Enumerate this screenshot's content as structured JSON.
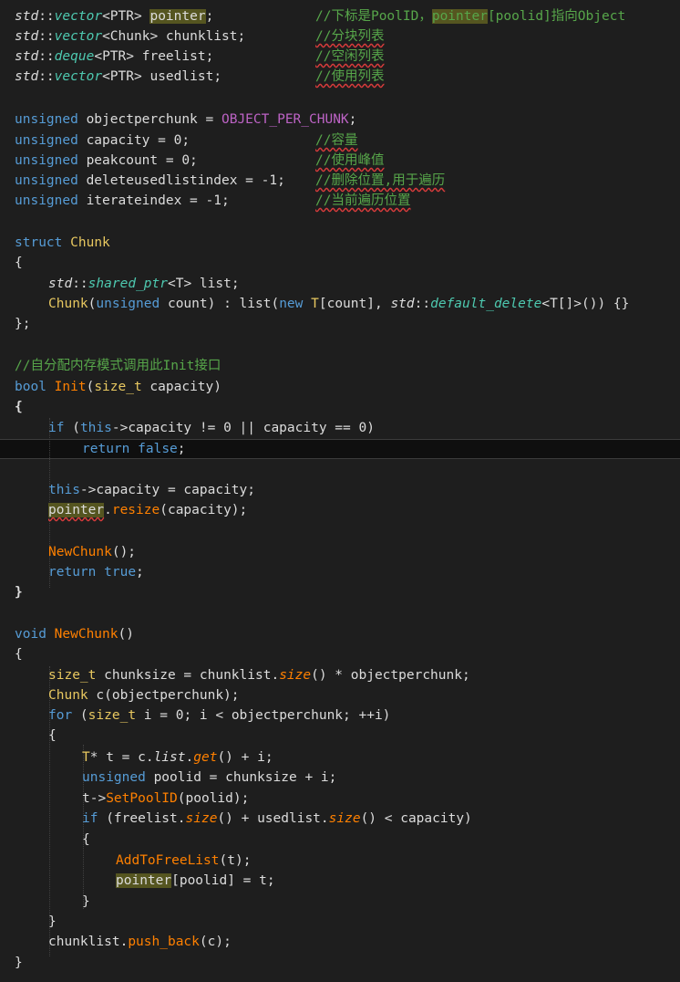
{
  "code": {
    "ln_vector_pointer": {
      "ns": "std",
      "sep": "::",
      "type": "vector",
      "lt": "<",
      "arg": "PTR",
      "gt": ">",
      "name": "pointer",
      "semi": ";",
      "comment_a": "//下标是PoolID，",
      "comment_hl": "pointer",
      "comment_b": "[poolid]指向Object"
    },
    "ln_vector_chunklist": {
      "ns": "std",
      "sep": "::",
      "type": "vector",
      "lt": "<",
      "arg": "Chunk",
      "gt": ">",
      "name": " chunklist",
      "semi": ";",
      "comment": "//分块列表"
    },
    "ln_deque_freelist": {
      "ns": "std",
      "sep": "::",
      "type": "deque",
      "lt": "<",
      "arg": "PTR",
      "gt": ">",
      "name": " freelist",
      "semi": ";",
      "comment": "//空闲列表"
    },
    "ln_vector_usedlist": {
      "ns": "std",
      "sep": "::",
      "type": "vector",
      "lt": "<",
      "arg": "PTR",
      "gt": ">",
      "name": " usedlist",
      "semi": ";",
      "comment": "//使用列表"
    },
    "ln_objectperchunk": {
      "kw": "unsigned",
      "rest": " objectperchunk = ",
      "macro": "OBJECT_PER_CHUNK",
      "semi": ";"
    },
    "ln_capacity": {
      "kw": "unsigned",
      "rest": " capacity = 0;",
      "comment": "//容量"
    },
    "ln_peakcount": {
      "kw": "unsigned",
      "rest": " peakcount = 0;",
      "comment": "//使用峰值"
    },
    "ln_deleteindex": {
      "kw": "unsigned",
      "rest": " deleteusedlistindex = -1;",
      "comment": "//删除位置,用于遍历"
    },
    "ln_iterateindex": {
      "kw": "unsigned",
      "rest": " iterateindex = -1;",
      "comment": "//当前遍历位置"
    },
    "ln_struct_chunk": {
      "kw": "struct",
      "name": "Chunk"
    },
    "ln_brace_open_1": {
      "text": "{"
    },
    "ln_shared_ptr": {
      "ns": "std",
      "sep": "::",
      "type": "shared_ptr",
      "lt": "<",
      "arg": "T",
      "gt": ">",
      "rest": " list;"
    },
    "ln_chunk_ctor": {
      "name": "Chunk",
      "p1": "(",
      "kw": "unsigned",
      "p2": " count) : list(",
      "kw2": "new",
      "sp": " ",
      "type": "T",
      "p3": "[count], ",
      "ns": "std",
      "sep": "::",
      "type2": "default_delete",
      "lt": "<",
      "arg": "T",
      "p4": "[]>()) {}"
    },
    "ln_struct_end": {
      "text": "};"
    },
    "ln_init_comment": {
      "comment": "//自分配内存模式调用此Init接口"
    },
    "ln_bool_init": {
      "kw": "bool",
      "sp": " ",
      "name": "Init",
      "p1": "(",
      "type": "size_t",
      "p2": " capacity)"
    },
    "ln_brace_open_2": {
      "text": "{"
    },
    "ln_if_this": {
      "kw": "if",
      "p1": " (",
      "kw2": "this",
      "p2": "->capacity != 0 || capacity == 0)"
    },
    "ln_return_false": {
      "kw": "return",
      "sp": " ",
      "kw2": "false",
      "semi": ";"
    },
    "ln_this_capacity": {
      "kw": "this",
      "rest": "->capacity = capacity;"
    },
    "ln_pointer_resize": {
      "name": "pointer",
      "dot": ".",
      "fn": "resize",
      "rest": "(capacity);"
    },
    "ln_newchunk_call": {
      "fn": "NewChunk",
      "rest": "();"
    },
    "ln_return_true": {
      "kw": "return",
      "sp": " ",
      "kw2": "true",
      "semi": ";"
    },
    "ln_brace_close_2": {
      "text": "}"
    },
    "ln_void_newchunk": {
      "kw": "void",
      "sp": " ",
      "fn": "NewChunk",
      "rest": "()"
    },
    "ln_brace_open_3": {
      "text": "{"
    },
    "ln_chunksize": {
      "type": "size_t",
      "p1": " chunksize = chunklist.",
      "fn": "size",
      "p2": "() * objectperchunk;"
    },
    "ln_chunk_c": {
      "name": "Chunk",
      "rest": " c(objectperchunk);"
    },
    "ln_for": {
      "kw": "for",
      "p1": " (",
      "type": "size_t",
      "p2": " i = 0; i < objectperchunk; ++i)"
    },
    "ln_brace_open_4": {
      "text": "{"
    },
    "ln_tptr": {
      "type": "T",
      "p1": "* t = c.",
      "v": "list",
      "dot": ".",
      "fn": "get",
      "p2": "() + i;"
    },
    "ln_poolid": {
      "kw": "unsigned",
      "rest": " poolid = chunksize + i;"
    },
    "ln_setpoolid": {
      "p1": "t->",
      "fn": "SetPoolID",
      "p2": "(poolid);"
    },
    "ln_if_freelist": {
      "kw": "if",
      "p1": " (freelist.",
      "fn": "size",
      "p2": "() + usedlist.",
      "fn2": "size",
      "p3": "() < capacity)"
    },
    "ln_brace_open_5": {
      "text": "{"
    },
    "ln_addtofree": {
      "fn": "AddToFreeList",
      "rest": "(t);"
    },
    "ln_pointer_assign": {
      "name": "pointer",
      "rest": "[poolid] = t;"
    },
    "ln_brace_close_5": {
      "text": "}"
    },
    "ln_brace_close_4": {
      "text": "}"
    },
    "ln_push_back": {
      "p1": "chunklist.",
      "fn": "push_back",
      "p2": "(c);"
    },
    "ln_brace_close_3": {
      "text": "}"
    }
  }
}
